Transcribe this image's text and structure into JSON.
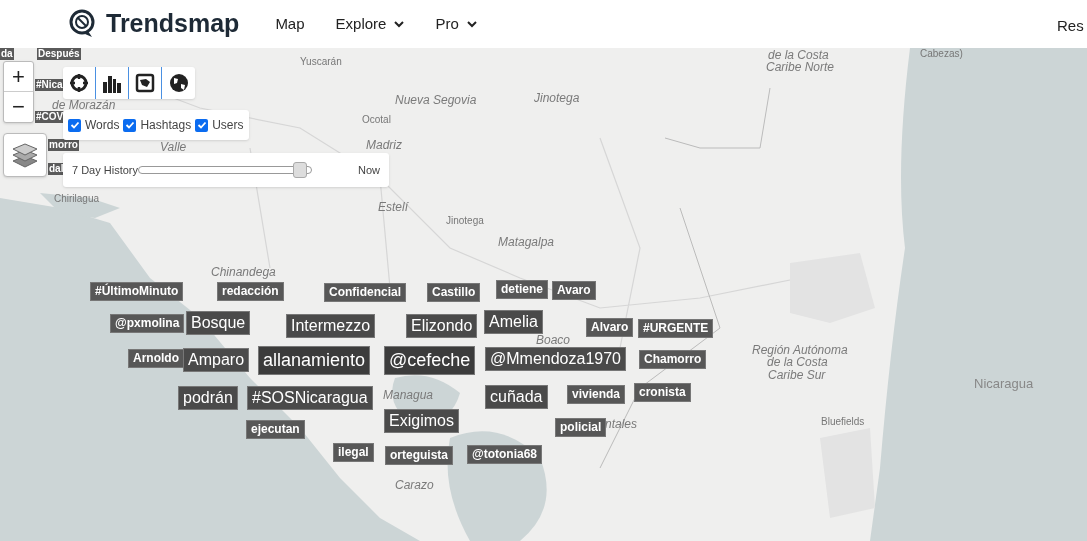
{
  "header": {
    "brand": "Trendsmap",
    "nav": [
      {
        "label": "Map",
        "kind": "link"
      },
      {
        "label": "Explore",
        "kind": "dropdown"
      },
      {
        "label": "Pro",
        "kind": "dropdown"
      }
    ],
    "edge_link": "Res"
  },
  "map": {
    "labels": [
      {
        "text": "Yuscarán",
        "kind": "city"
      },
      {
        "text": "Nueva Segovia",
        "kind": "region"
      },
      {
        "text": "Jinotega",
        "kind": "region"
      },
      {
        "text": "Ocotal",
        "kind": "city"
      },
      {
        "text": "Madriz",
        "kind": "region"
      },
      {
        "text": "de la Costa",
        "kind": "region"
      },
      {
        "text": "Caribe Norte",
        "kind": "region"
      },
      {
        "text": "Cabezas)",
        "kind": "city"
      },
      {
        "text": "de Morazán",
        "kind": "region"
      },
      {
        "text": "Valle",
        "kind": "region"
      },
      {
        "text": "Chirilagua",
        "kind": "city"
      },
      {
        "text": "Estelí",
        "kind": "region"
      },
      {
        "text": "Jinotega",
        "kind": "city"
      },
      {
        "text": "Matagalpa",
        "kind": "region"
      },
      {
        "text": "Chinandega",
        "kind": "region"
      },
      {
        "text": "Boaco",
        "kind": "region"
      },
      {
        "text": "Managua",
        "kind": "region"
      },
      {
        "text": "ntales",
        "kind": "region"
      },
      {
        "text": "Carazo",
        "kind": "region"
      },
      {
        "text": "Región Autónoma",
        "kind": "region"
      },
      {
        "text": "de la Costa",
        "kind": "region"
      },
      {
        "text": "Caribe Sur",
        "kind": "region"
      },
      {
        "text": "Bluefields",
        "kind": "city"
      },
      {
        "text": "Nicaragua",
        "kind": "country"
      }
    ],
    "tag_fragments": [
      "da",
      "Después",
      "#Nica",
      "#COV",
      "morro",
      "dal"
    ],
    "tags": [
      {
        "text": "#ÚltimoMinuto",
        "kind": "small"
      },
      {
        "text": "redacción",
        "kind": "small"
      },
      {
        "text": "Confidencial",
        "kind": "small"
      },
      {
        "text": "Castillo",
        "kind": "small"
      },
      {
        "text": "detiene",
        "kind": "small"
      },
      {
        "text": "Avaro",
        "kind": "small"
      },
      {
        "text": "@pxmolina",
        "kind": "small"
      },
      {
        "text": "Bosque",
        "kind": "medium"
      },
      {
        "text": "Intermezzo",
        "kind": "medium"
      },
      {
        "text": "Elizondo",
        "kind": "medium"
      },
      {
        "text": "Amelia",
        "kind": "medium"
      },
      {
        "text": "Alvaro",
        "kind": "small"
      },
      {
        "text": "#URGENTE",
        "kind": "small"
      },
      {
        "text": "Arnoldo",
        "kind": "small"
      },
      {
        "text": "Amparo",
        "kind": "medium"
      },
      {
        "text": "allanamiento",
        "kind": "large"
      },
      {
        "text": "@cefeche",
        "kind": "large"
      },
      {
        "text": "@Mmendoza1970",
        "kind": "medium"
      },
      {
        "text": "Chamorro",
        "kind": "small"
      },
      {
        "text": "podrán",
        "kind": "medium"
      },
      {
        "text": "#SOSNicaragua",
        "kind": "medium"
      },
      {
        "text": "ejecutan",
        "kind": "small"
      },
      {
        "text": "Exigimos",
        "kind": "medium"
      },
      {
        "text": "cuñada",
        "kind": "medium"
      },
      {
        "text": "vivienda",
        "kind": "small"
      },
      {
        "text": "cronista",
        "kind": "small"
      },
      {
        "text": "policial",
        "kind": "small"
      },
      {
        "text": "ilegal",
        "kind": "small"
      },
      {
        "text": "orteguista",
        "kind": "small"
      },
      {
        "text": "@totonia68",
        "kind": "small"
      }
    ]
  },
  "controls": {
    "zoom_in": "+",
    "zoom_out": "−",
    "filters": [
      {
        "label": "Words",
        "checked": true
      },
      {
        "label": "Hashtags",
        "checked": true
      },
      {
        "label": "Users",
        "checked": true
      }
    ],
    "history": {
      "label": "7 Day History",
      "level": 0.97,
      "end_label": "Now"
    }
  }
}
